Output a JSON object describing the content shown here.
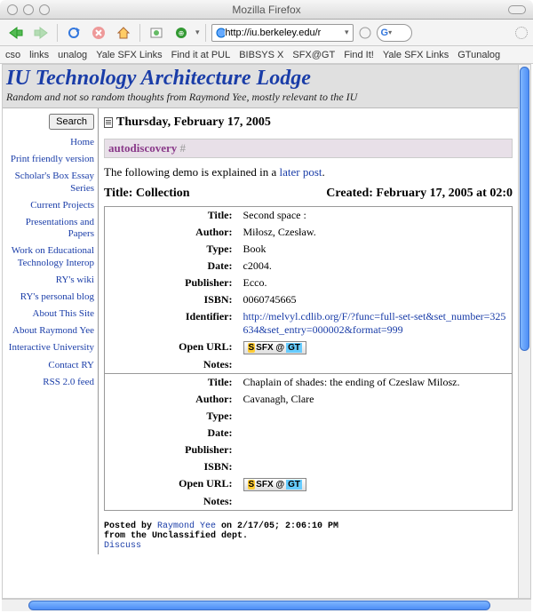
{
  "window": {
    "title": "Mozilla Firefox"
  },
  "toolbar": {
    "url": "http://iu.berkeley.edu/r",
    "search_placeholder": ""
  },
  "bookmarks": [
    "cso",
    "links",
    "unalog",
    "Yale SFX Links",
    "Find it at PUL",
    "BIBSYS X",
    "SFX@GT",
    "Find It!",
    "Yale SFX Links",
    "GTunalog"
  ],
  "blog": {
    "title": "IU Technology Architecture Lodge",
    "subtitle": "Random and not so random thoughts from Raymond Yee, mostly relevant to the IU"
  },
  "sidebar": {
    "search_label": "Search",
    "links": [
      "Home",
      "Print friendly version",
      "Scholar's Box Essay Series",
      "Current Projects",
      "Presentations and Papers",
      "Work on Educational Technology Interop",
      "RY's wiki",
      "RY's personal blog",
      "About This Site",
      "About Raymond Yee",
      "Interactive University",
      "Contact RY",
      "RSS 2.0 feed"
    ]
  },
  "post": {
    "date": "Thursday, February 17, 2005",
    "title": "autodiscovery",
    "hash": "#",
    "intro_prefix": "The following demo is explained in a ",
    "intro_link": "later post",
    "intro_suffix": ".",
    "collection_label": "Title: Collection",
    "created": "Created: February 17, 2005 at 02:0",
    "records": [
      {
        "Title": "Second space :",
        "Author": "Miłosz, Czesław.",
        "Type": "Book",
        "Date": "c2004.",
        "Publisher": "Ecco.",
        "ISBN": "0060745665",
        "Identifier": "http://melvyl.cdlib.org/F/?func=full-set-set&set_number=325634&set_entry=000002&format=999",
        "OpenURL": "sfx",
        "Notes": ""
      },
      {
        "Title": "Chaplain of shades: the ending of Czeslaw Milosz.",
        "Author": "Cavanagh, Clare",
        "Type": "",
        "Date": "",
        "Publisher": "",
        "ISBN": "",
        "OpenURL": "sfx",
        "Notes": ""
      }
    ],
    "labels": {
      "Title": "Title:",
      "Author": "Author:",
      "Type": "Type:",
      "Date": "Date:",
      "Publisher": "Publisher:",
      "ISBN": "ISBN:",
      "Identifier": "Identifier:",
      "OpenURL": "Open URL:",
      "OpenURL2": "Open URL:",
      "Notes": "Notes:"
    },
    "footer": {
      "line1_a": "Posted by ",
      "author": "Raymond Yee",
      "line1_b": " on 2/17/05; 2:06:10 PM",
      "line2": "from the Unclassified dept.",
      "discuss": "Discuss"
    }
  }
}
